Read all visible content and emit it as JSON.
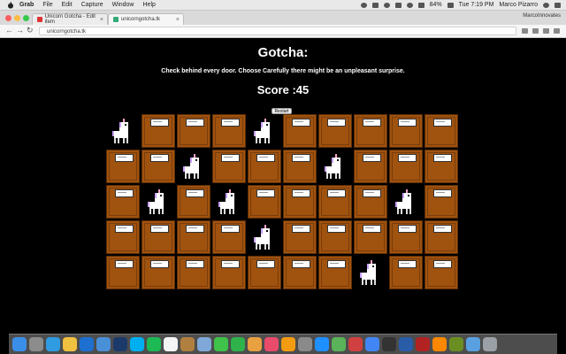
{
  "menubar": {
    "app": "Grab",
    "items": [
      "File",
      "Edit",
      "Capture",
      "Window",
      "Help"
    ],
    "battery": "84%",
    "clock": "Tue 7:19 PM",
    "user": "Marco Pizarro"
  },
  "browser": {
    "tabs": [
      {
        "label": "Unicorn Gotcha - Edit item"
      },
      {
        "label": "unicorngotcha.tk"
      }
    ],
    "profile": "MarcoInnovates",
    "url": "unicorngotcha.tk"
  },
  "game": {
    "title": "Gotcha:",
    "subtitle": "Check behind every door. Choose Carefully there might be an unpleasant surprise.",
    "score_label": "Score :",
    "score_value": "45",
    "restart_label": "Restart",
    "board": [
      [
        "unicorn",
        "door",
        "door",
        "door",
        "unicorn",
        "door",
        "door",
        "door",
        "door",
        "door"
      ],
      [
        "door",
        "door",
        "unicorn",
        "door",
        "door",
        "door",
        "unicorn",
        "door",
        "door",
        "door"
      ],
      [
        "door",
        "unicorn",
        "door",
        "unicorn",
        "door",
        "door",
        "door",
        "door",
        "unicorn",
        "door"
      ],
      [
        "door",
        "door",
        "door",
        "door",
        "unicorn",
        "door",
        "door",
        "door",
        "door",
        "door"
      ],
      [
        "door",
        "door",
        "door",
        "door",
        "door",
        "door",
        "door",
        "unicorn",
        "door",
        "door"
      ]
    ]
  },
  "colors": {
    "door": "#a0520f",
    "board_background": "#000000",
    "unicorn_horn": "#f5a0c8"
  },
  "dock": {
    "icons": [
      "finder-icon",
      "launchpad-icon",
      "safari-icon",
      "notes-icon",
      "w-app-icon",
      "folder-icon",
      "photoshop-icon",
      "skype-icon",
      "spotify-icon",
      "calendar-icon",
      "contacts-icon",
      "preview-icon",
      "messages-icon",
      "facetime-icon",
      "photos-icon",
      "itunes-icon",
      "ibooks-icon",
      "system-prefs-icon",
      "app-store-icon",
      "maps-icon",
      "sketchup-icon",
      "chrome-icon",
      "terminal-icon",
      "xcode-icon",
      "filezilla-icon",
      "vlc-icon",
      "minecraft-icon",
      "downloads-icon",
      "trash-icon"
    ]
  }
}
